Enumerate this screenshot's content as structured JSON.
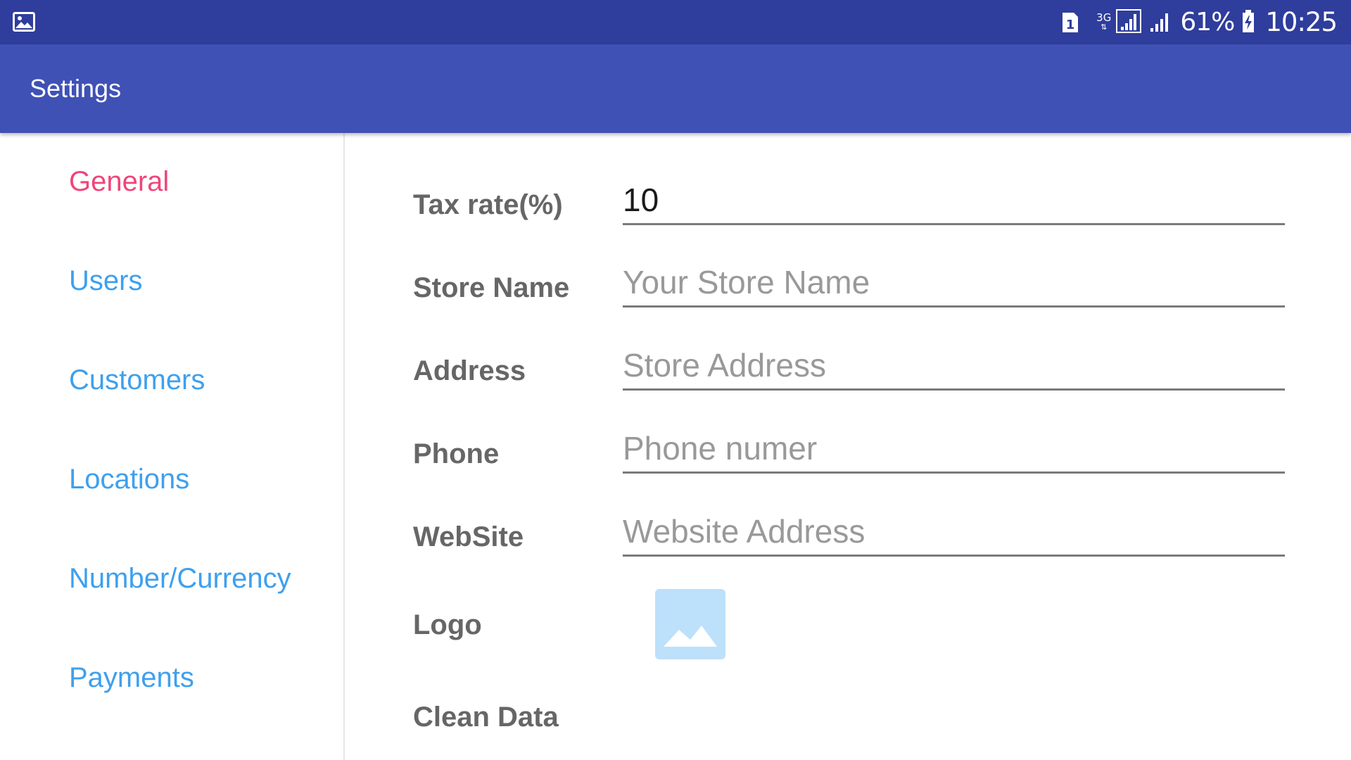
{
  "status_bar": {
    "sim_slot": "1",
    "network_type": "3G",
    "battery_percent": "61%",
    "time": "10:25",
    "icons": {
      "left": "gallery-icon",
      "sim": "sim-card-icon",
      "signal_1": "signal-strength-icon",
      "signal_2": "signal-strength-icon",
      "battery": "battery-charging-icon"
    }
  },
  "app_bar": {
    "title": "Settings"
  },
  "sidebar": {
    "items": [
      {
        "label": "General",
        "active": true
      },
      {
        "label": "Users",
        "active": false
      },
      {
        "label": "Customers",
        "active": false
      },
      {
        "label": "Locations",
        "active": false
      },
      {
        "label": "Number/Currency",
        "active": false
      },
      {
        "label": "Payments",
        "active": false
      }
    ]
  },
  "form": {
    "tax_rate": {
      "label": "Tax rate(%)",
      "value": "10"
    },
    "store_name": {
      "label": "Store Name",
      "placeholder": "Your Store Name"
    },
    "address": {
      "label": "Address",
      "placeholder": "Store Address"
    },
    "phone": {
      "label": "Phone",
      "placeholder": "Phone numer"
    },
    "website": {
      "label": "WebSite",
      "placeholder": "Website Address"
    },
    "logo": {
      "label": "Logo",
      "icon": "image-placeholder-icon"
    },
    "clean_data": {
      "label": "Clean Data"
    }
  },
  "colors": {
    "status_bar": "#2f3d9c",
    "app_bar": "#3f51b5",
    "sidebar_active": "#f0457a",
    "sidebar_link": "#3ea0ee",
    "label": "#666666",
    "placeholder": "#999999",
    "logo_bg": "#bde0fb"
  }
}
